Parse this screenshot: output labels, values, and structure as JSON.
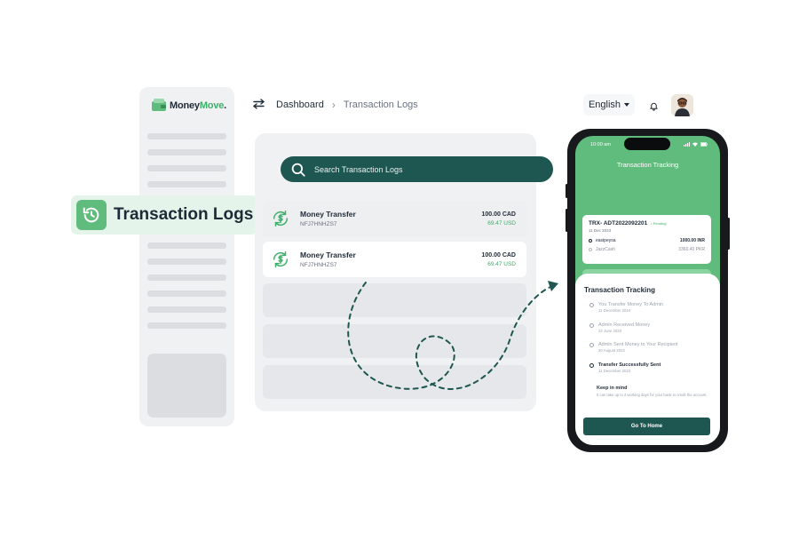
{
  "brand": {
    "name_part1": "Money",
    "name_part2": "Move",
    "suffix": "."
  },
  "sidebar": {
    "active_item": {
      "label": "Transaction Logs",
      "icon": "history-icon"
    }
  },
  "header": {
    "breadcrumb": {
      "root": "Dashboard",
      "separator": "›",
      "current": "Transaction Logs"
    },
    "language": "English"
  },
  "search": {
    "placeholder": "Search Transaction Logs"
  },
  "transactions": [
    {
      "title": "Money Transfer",
      "id": "NFJ7HNHZS7",
      "amount": "100.00 CAD",
      "converted": "69.47 USD"
    },
    {
      "title": "Money Transfer",
      "id": "NFJ7HNHZS7",
      "amount": "100.00 CAD",
      "converted": "69.47 USD"
    }
  ],
  "phone": {
    "status_time": "10:00 am",
    "title": "Transaction Tracking",
    "trx": {
      "id": "TRX- ADT2022092201",
      "status": "• Pending",
      "date": "11 Dec 2023",
      "from_name": "easipeysa",
      "from_amount": "1000.00 INR",
      "to_name": "JazzCash",
      "to_amount": "3360.40 PKR"
    },
    "sheet_title": "Transaction Tracking",
    "steps": [
      {
        "title": "You Transfer Money To Admin",
        "date": "11 December 2024"
      },
      {
        "title": "Admin Received Money",
        "date": "22 June 2023"
      },
      {
        "title": "Admin Sent Money to Your Recipient",
        "date": "20 August 2022"
      },
      {
        "title": "Transfer Successfully Sent",
        "date": "11 December 2023"
      }
    ],
    "note_title": "Keep in mind",
    "note_text": "It can take up to 2 working days for your bank to credit the account.",
    "home_button": "Go To Home"
  },
  "colors": {
    "brand_green": "#5fbc7c",
    "dark_teal": "#1e5751",
    "accent_green": "#3fae6b",
    "panel_gray": "#f0f1f3"
  }
}
